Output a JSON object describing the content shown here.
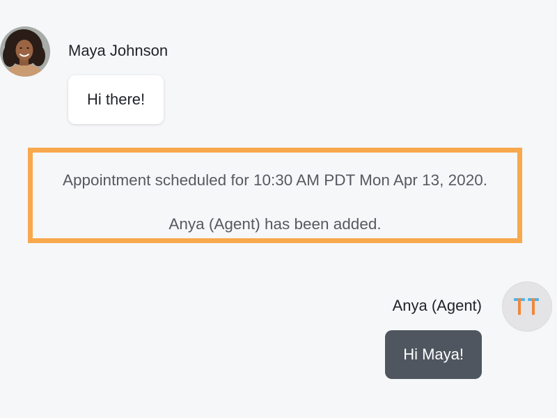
{
  "conversation": {
    "incoming": {
      "sender_name": "Maya Johnson",
      "avatar_icon": "user-photo-avatar",
      "message": "Hi there!"
    },
    "system_notice": {
      "line1": "Appointment scheduled for 10:30 AM PDT Mon Apr 13, 2020.",
      "line2": "Anya (Agent) has been added.",
      "border_color": "#f8a84d"
    },
    "outgoing": {
      "sender_name": "Anya (Agent)",
      "avatar_icon": "tt-logo-icon",
      "message": "Hi Maya!",
      "bubble_color": "#4f565f"
    }
  }
}
